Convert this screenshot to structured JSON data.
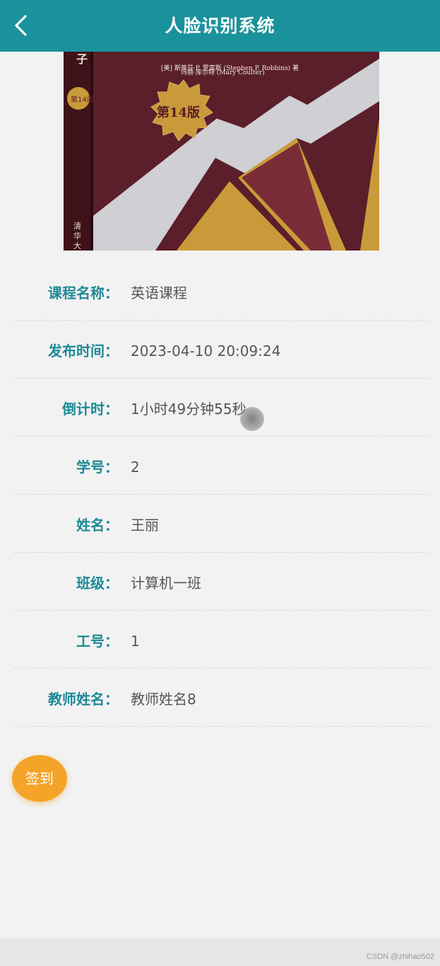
{
  "header": {
    "title": "人脸识别系统",
    "back_icon": "chevron-left-icon",
    "background": "#1a929b"
  },
  "cover": {
    "edition_badge": "第14版",
    "authors_line1": "[美] 斯蒂芬·P. 罗宾斯 (Stephen P. Robbins) 著",
    "authors_line2": "玛丽·库尔特 (Mary Coulter)"
  },
  "details": [
    {
      "label": "课程名称：",
      "value": "英语课程"
    },
    {
      "label": "发布时间：",
      "value": "2023-04-10 20:09:24"
    },
    {
      "label": "倒计时：",
      "value": "1小时49分钟55秒"
    },
    {
      "label": "学号：",
      "value": "2"
    },
    {
      "label": "姓名：",
      "value": "王丽"
    },
    {
      "label": "班级：",
      "value": "计算机一班"
    },
    {
      "label": "工号：",
      "value": "1"
    },
    {
      "label": "教师姓名：",
      "value": "教师姓名8"
    }
  ],
  "actions": {
    "sign_in_label": "签到",
    "sign_in_color": "#f4a428"
  },
  "watermark": "CSDN @zhihao502"
}
